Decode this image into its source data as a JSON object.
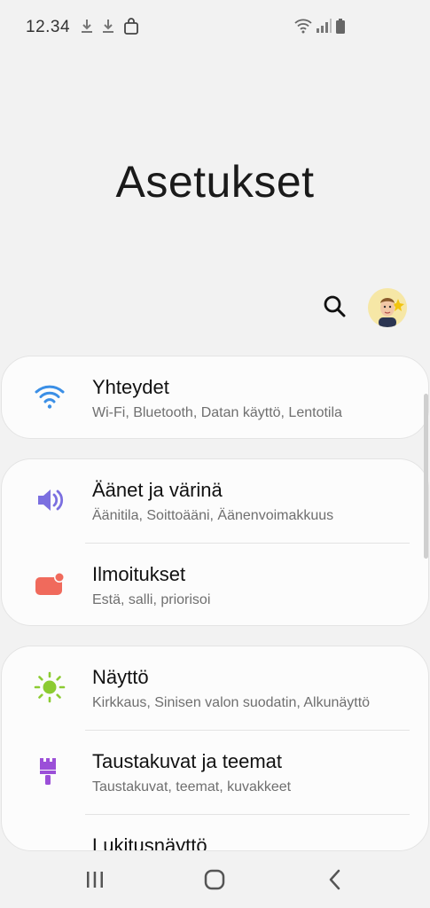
{
  "status_bar": {
    "time": "12.34",
    "left_icons": [
      "download-icon",
      "download-icon",
      "shopping-bag-icon"
    ],
    "right_icons": [
      "wifi-icon",
      "signal-icon",
      "battery-icon"
    ]
  },
  "header": {
    "title": "Asetukset",
    "search_icon": "search-icon",
    "avatar_icon": "profile-avatar"
  },
  "cards": [
    {
      "items": [
        {
          "title": "Yhteydet",
          "subtitle": "Wi-Fi, Bluetooth, Datan käyttö, Lentotila",
          "icon": "wifi-icon",
          "color": "#3b8fe6"
        }
      ]
    },
    {
      "items": [
        {
          "title": "Äänet ja värinä",
          "subtitle": "Äänitila, Soittoääni, Äänenvoimakkuus",
          "icon": "speaker-icon",
          "color": "#7b6fe0"
        },
        {
          "title": "Ilmoitukset",
          "subtitle": "Estä, salli, priorisoi",
          "icon": "notification-icon",
          "color": "#f06a5c"
        }
      ]
    },
    {
      "items": [
        {
          "title": "Näyttö",
          "subtitle": "Kirkkaus, Sinisen valon suodatin, Alkunäyttö",
          "icon": "brightness-icon",
          "color": "#8ccb32"
        },
        {
          "title": "Taustakuvat ja teemat",
          "subtitle": "Taustakuvat, teemat, kuvakkeet",
          "icon": "paintbrush-icon",
          "color": "#9b4fd8"
        },
        {
          "title": "Lukitusnäyttö",
          "subtitle": "",
          "icon": "lock-icon",
          "color": "#4a8fe0"
        }
      ]
    }
  ],
  "nav_bar": {
    "buttons": [
      "recent-apps-icon",
      "home-icon",
      "back-icon"
    ]
  }
}
